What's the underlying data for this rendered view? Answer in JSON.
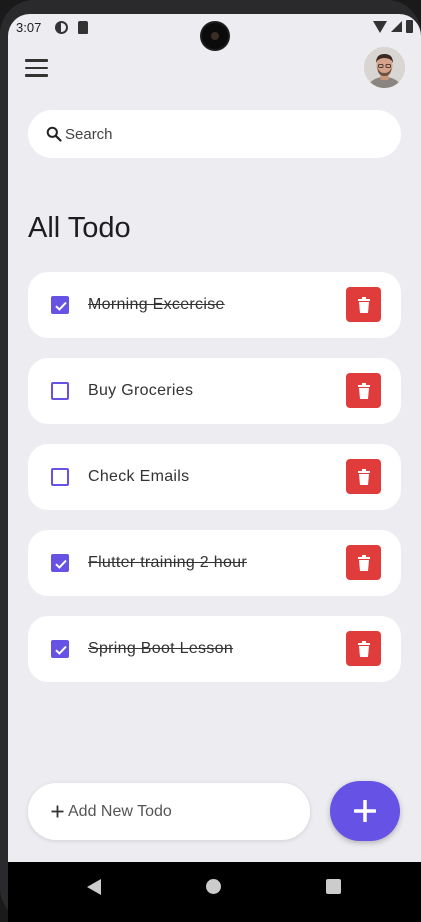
{
  "status_bar": {
    "time": "3:07"
  },
  "search": {
    "placeholder": "Search"
  },
  "page_title": "All Todo",
  "todos": [
    {
      "text": "Morning Excercise",
      "done": true
    },
    {
      "text": "Buy Groceries",
      "done": false
    },
    {
      "text": "Check Emails",
      "done": false
    },
    {
      "text": "Flutter training 2 hour",
      "done": true
    },
    {
      "text": "Spring Boot Lesson",
      "done": true
    }
  ],
  "add_todo": {
    "placeholder": "Add New Todo",
    "plus_glyph": "+"
  },
  "icons": {
    "menu": "hamburger-menu-icon",
    "avatar": "user-avatar",
    "search": "search-icon",
    "checkbox": "check-icon",
    "delete": "trash-icon",
    "fab": "plus-icon"
  },
  "colors": {
    "accent": "#6652e4",
    "delete": "#e03c3c",
    "background": "#edecf1",
    "card": "#ffffff"
  }
}
